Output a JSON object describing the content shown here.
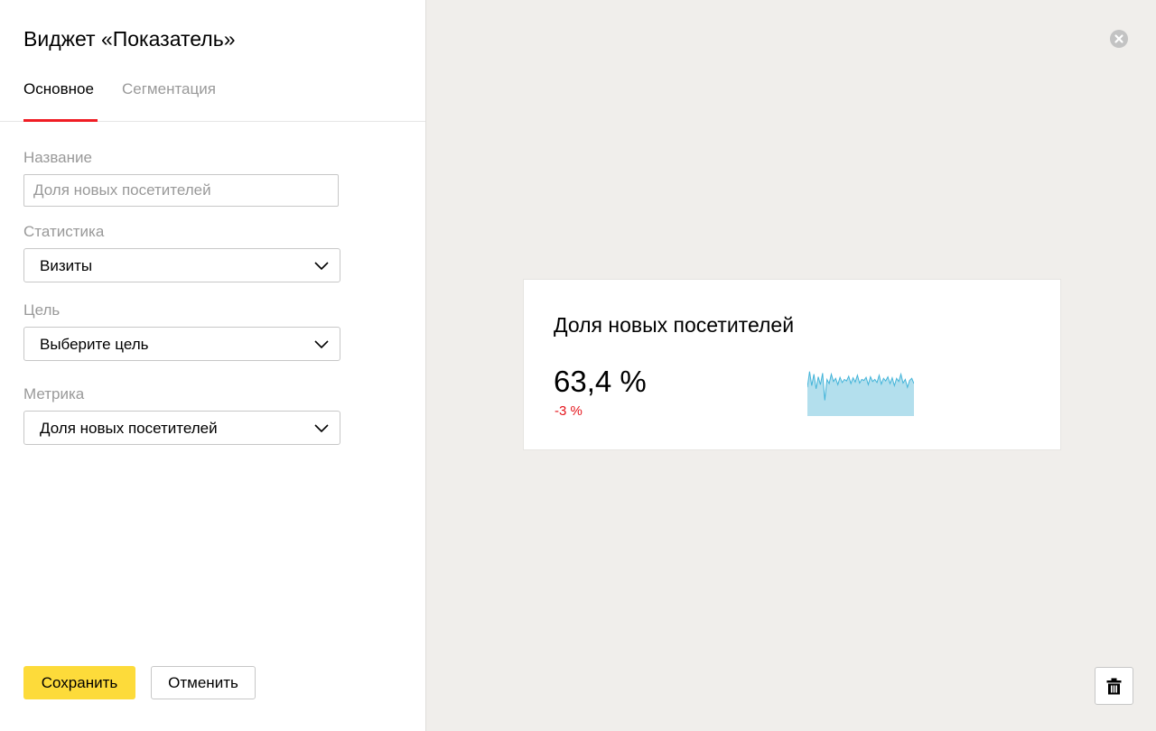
{
  "dialog": {
    "title": "Виджет «Показатель»",
    "tabs": [
      {
        "label": "Основное",
        "active": true
      },
      {
        "label": "Сегментация",
        "active": false
      }
    ]
  },
  "form": {
    "name": {
      "label": "Название",
      "placeholder": "Доля новых посетителей",
      "value": ""
    },
    "statistics": {
      "label": "Статистика",
      "value": "Визиты"
    },
    "goal": {
      "label": "Цель",
      "value": "Выберите цель"
    },
    "metric": {
      "label": "Метрика",
      "value": "Доля новых посетителей"
    }
  },
  "actions": {
    "save_label": "Сохранить",
    "cancel_label": "Отменить"
  },
  "preview": {
    "title": "Доля новых посетителей",
    "value": "63,4 %",
    "delta": "-3 %",
    "sparkline": [
      55,
      85,
      58,
      80,
      52,
      75,
      60,
      82,
      30,
      70,
      62,
      80,
      66,
      72,
      60,
      74,
      64,
      70,
      67,
      76,
      62,
      73,
      65,
      78,
      63,
      70,
      68,
      74,
      60,
      75,
      66,
      70,
      64,
      78,
      61,
      72,
      67,
      75,
      62,
      73,
      58,
      72,
      66,
      80,
      63,
      70,
      55,
      68,
      72,
      62
    ],
    "colors": {
      "fill": "#b3dfed",
      "line": "#43b4d9",
      "delta": "#e5141b"
    }
  },
  "icons": {
    "close": "close-circle-icon",
    "delete": "trash-icon",
    "dropdown": "chevron-down-icon"
  },
  "colors": {
    "accent": "#f01d24",
    "save_button": "#fddb3a",
    "background": "#f0eeeb"
  }
}
